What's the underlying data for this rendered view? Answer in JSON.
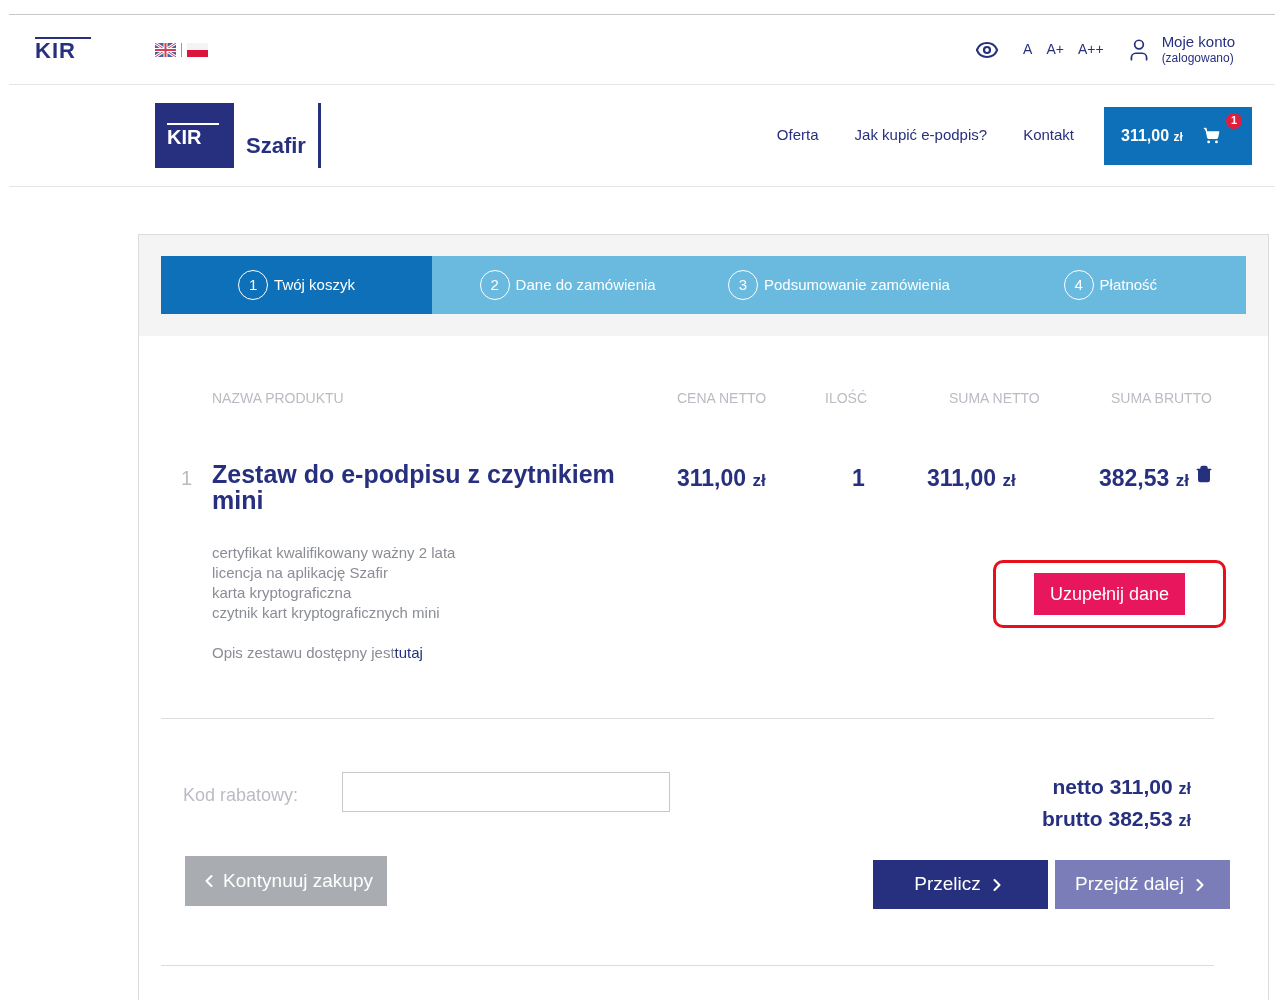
{
  "top_bar": {
    "logo": "KIR",
    "languages": [
      {
        "kind": "uk",
        "selected": false
      },
      {
        "kind": "pl",
        "selected": true
      }
    ],
    "font_sizes": [
      "A",
      "A+",
      "A++"
    ],
    "account": {
      "label": "Moje konto",
      "status": "(zalogowano)"
    }
  },
  "header": {
    "logo_mark": "KIR",
    "logo_name": "Szafir",
    "nav": [
      "Oferta",
      "Jak kupić e-podpis?",
      "Kontakt"
    ],
    "cart": {
      "amount": "311,00",
      "currency": "zł",
      "count": "1"
    }
  },
  "steps": [
    {
      "number": "1",
      "label": "Twój koszyk",
      "selected": true
    },
    {
      "number": "2",
      "label": "Dane do zamówienia",
      "selected": false
    },
    {
      "number": "3",
      "label": "Podsumowanie zamówienia",
      "selected": false
    },
    {
      "number": "4",
      "label": "Płatność",
      "selected": false
    }
  ],
  "table": {
    "columns": [
      "NAZWA PRODUKTU",
      "CENA NETTO",
      "ILOŚĆ",
      "SUMA NETTO",
      "SUMA BRUTTO"
    ],
    "rows": [
      {
        "index": "1",
        "name": "Zestaw do e-podpisu z czytnikiem mini",
        "price": {
          "amount": "311,00",
          "currency": "zł"
        },
        "quantity": "1",
        "net": {
          "amount": "311,00",
          "currency": "zł"
        },
        "gross": {
          "amount": "382,53",
          "currency": "zł"
        },
        "contents": [
          "certyfikat kwalifikowany ważny 2 lata",
          "licencja na aplikację Szafir",
          "karta kryptograficzna",
          "czytnik kart kryptograficznych mini"
        ],
        "description": "Opis zestawu dostępny jest",
        "link": "tutaj",
        "action": "Uzupełnij dane",
        "highlighted": true
      }
    ]
  },
  "discount": {
    "label": "Kod rabatowy:"
  },
  "totals": [
    {
      "label": "netto",
      "amount": "311,00",
      "currency": "zł"
    },
    {
      "label": "brutto",
      "amount": "382,53",
      "currency": "zł"
    }
  ],
  "buttons": [
    {
      "kind": "back",
      "label": "Kontynuuj zakupy",
      "disabled": true
    },
    {
      "kind": "next",
      "label": "Przelicz",
      "disabled": false
    },
    {
      "kind": "next",
      "label": "Przejdź dalej",
      "disabled": true
    }
  ]
}
